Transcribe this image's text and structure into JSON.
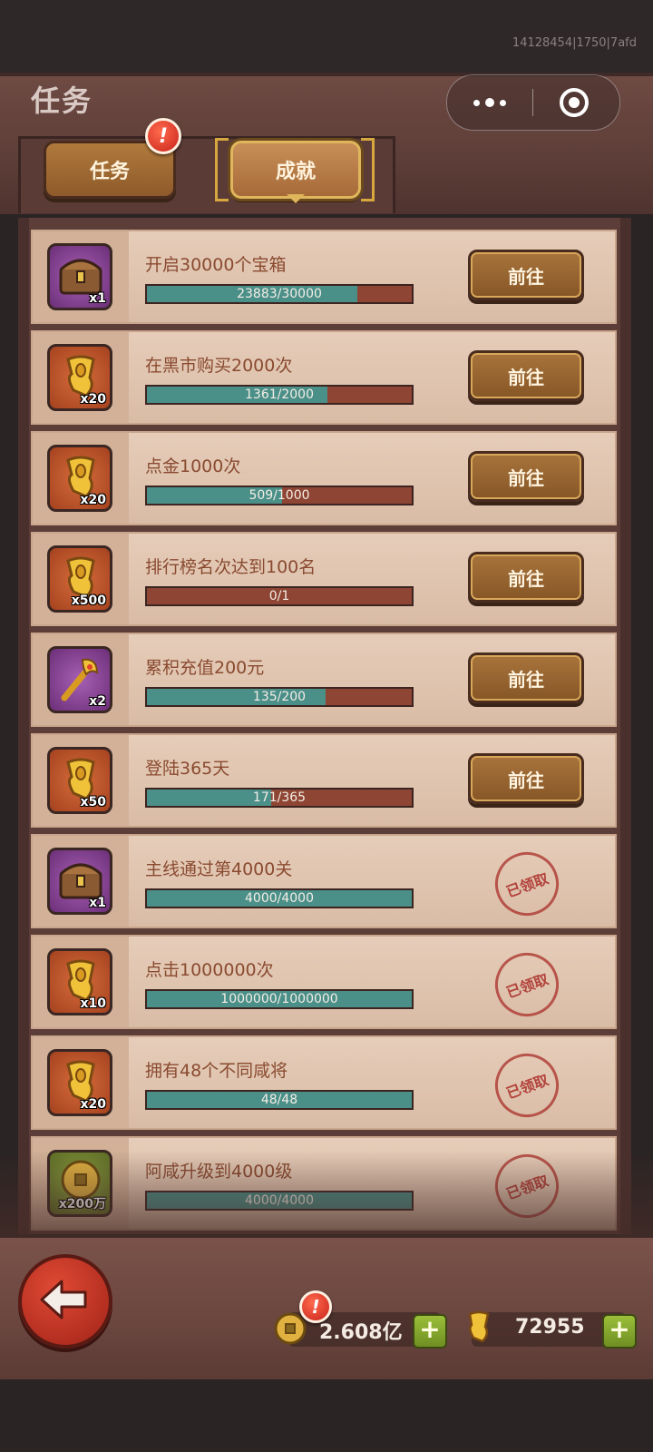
{
  "status": {
    "build_id": "14128454|1750|7afd"
  },
  "header": {
    "title": "任务"
  },
  "tabs": [
    {
      "label": "任务",
      "badge": "!"
    },
    {
      "label": "成就"
    }
  ],
  "rows": [
    {
      "title": "开启30000个宝箱",
      "icon": "chest-icon",
      "qty": "x1",
      "progress_text": "23883/30000",
      "progress": 0.796,
      "action": "前往",
      "claimed": false
    },
    {
      "title": "在黑市购买2000次",
      "icon": "gold-scroll-icon",
      "qty": "x20",
      "progress_text": "1361/2000",
      "progress": 0.68,
      "action": "前往",
      "claimed": false
    },
    {
      "title": "点金1000次",
      "icon": "gold-scroll-icon",
      "qty": "x20",
      "progress_text": "509/1000",
      "progress": 0.509,
      "action": "前往",
      "claimed": false
    },
    {
      "title": "排行榜名次达到100名",
      "icon": "gold-scroll-icon",
      "qty": "x500",
      "progress_text": "0/1",
      "progress": 0,
      "action": "前往",
      "claimed": false
    },
    {
      "title": "累积充值200元",
      "icon": "golden-scepter-icon",
      "qty": "x2",
      "progress_text": "135/200",
      "progress": 0.675,
      "action": "前往",
      "claimed": false
    },
    {
      "title": "登陆365天",
      "icon": "gold-scroll-icon",
      "qty": "x50",
      "progress_text": "171/365",
      "progress": 0.468,
      "action": "前往",
      "claimed": false
    },
    {
      "title": "主线通过第4000关",
      "icon": "chest-icon",
      "qty": "x1",
      "progress_text": "4000/4000",
      "progress": 1,
      "claimed": true,
      "stamp": "已领取"
    },
    {
      "title": "点击1000000次",
      "icon": "gold-scroll-icon",
      "qty": "x10",
      "progress_text": "1000000/1000000",
      "progress": 1,
      "claimed": true,
      "stamp": "已领取"
    },
    {
      "title": "拥有48个不同咸将",
      "icon": "gold-scroll-icon",
      "qty": "x20",
      "progress_text": "48/48",
      "progress": 1,
      "claimed": true,
      "stamp": "已领取"
    },
    {
      "title": "阿咸升级到4000级",
      "icon": "coin-icon",
      "qty": "x200万",
      "progress_text": "4000/4000",
      "progress": 1,
      "claimed": true,
      "stamp": "已领取"
    }
  ],
  "resources": {
    "coins": {
      "value": "2.608亿",
      "badge": "!"
    },
    "scrolls": {
      "value": "72955"
    },
    "plus": "+"
  }
}
